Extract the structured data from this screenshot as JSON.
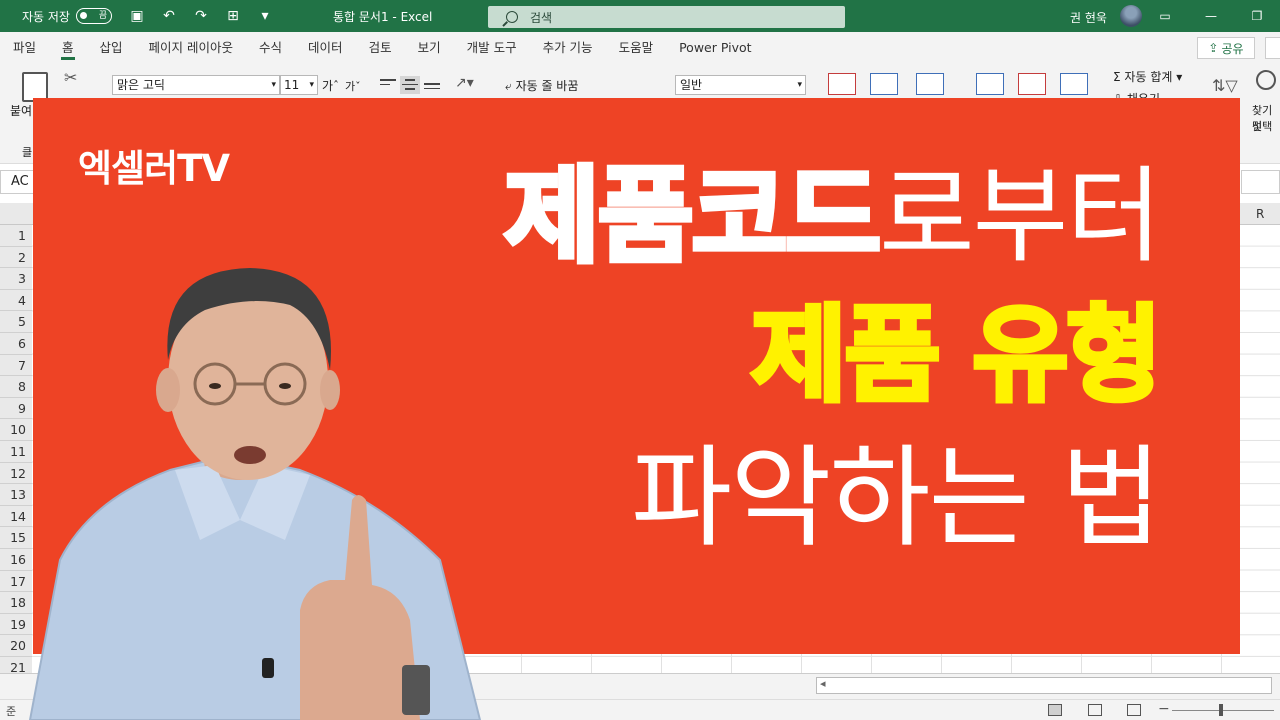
{
  "titlebar": {
    "autosave_label": "자동 저장",
    "autosave_state": "끔",
    "doc_title": "통합 문서1  -  Excel",
    "search_placeholder": "검색",
    "user_name": "권 현욱"
  },
  "tabs": [
    "파일",
    "홈",
    "삽입",
    "페이지 레이아웃",
    "수식",
    "데이터",
    "검토",
    "보기",
    "개발 도구",
    "추가 기능",
    "도움말",
    "Power Pivot"
  ],
  "active_tab": "홈",
  "share_label": "공유",
  "ribbon": {
    "paste_label": "붙여",
    "font_name": "맑은 고딕",
    "font_size": "11",
    "grow_font": "가ˆ",
    "shrink_font": "가ˇ",
    "wrap_text": "자동 줄 바꿈",
    "number_format": "일반",
    "autosum": "자동 합계",
    "fill": "채우기",
    "find_select_1": "찾기 및",
    "find_select_2": "선택",
    "clipboard_group": "클"
  },
  "namebox_value": "AC",
  "column_header_visible": "R",
  "row_numbers": [
    "1",
    "2",
    "3",
    "4",
    "5",
    "6",
    "7",
    "8",
    "9",
    "10",
    "11",
    "12",
    "13",
    "14",
    "15",
    "16",
    "17",
    "18",
    "19",
    "20",
    "21"
  ],
  "status": {
    "ready": "준"
  },
  "thumbnail": {
    "brand": "엑셀러TV",
    "line1_bold": "제품코드",
    "line1_regular": "로부터",
    "line2": "제품 유형",
    "line3": "파악하는 법"
  },
  "colors": {
    "excel_green": "#217346",
    "panel_red": "#ee4325",
    "highlight_yellow": "#fff200"
  }
}
